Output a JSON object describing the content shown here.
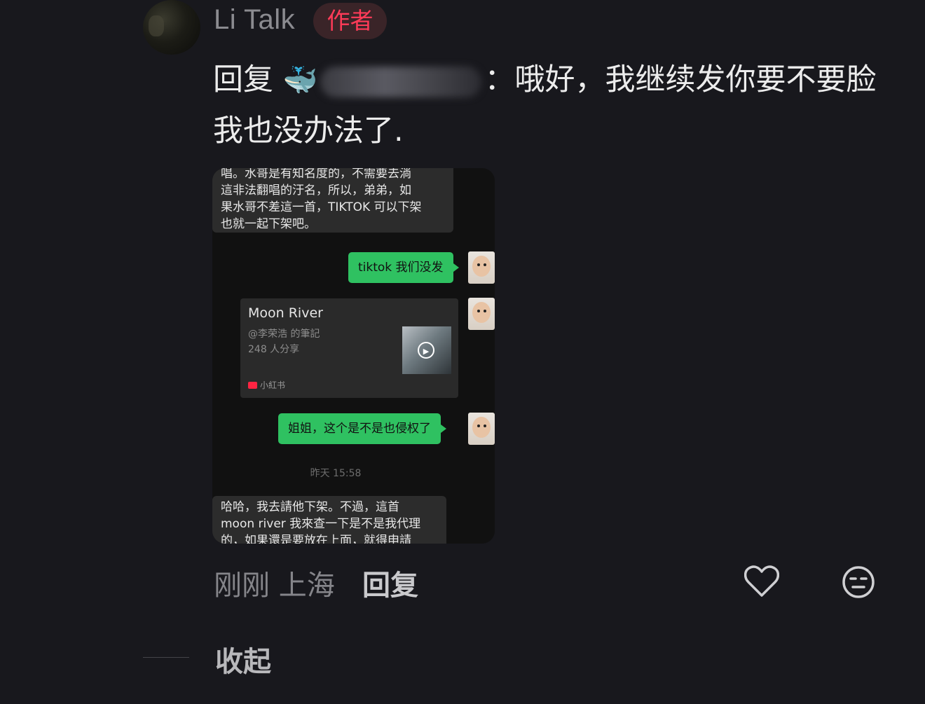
{
  "author": {
    "name": "Li Talk",
    "badge": "作者"
  },
  "comment": {
    "prefix": "回复",
    "emoji": "🐳",
    "redacted_name": "(blurred)",
    "text": "：哦好，我继续发你要不要脸我也没办法了."
  },
  "screenshot": {
    "top_message": "唱。水哥是有知名度的，不需要去淌\n這非法翻唱的汙名，所以，弟弟，如\n果水哥不差這一首，TIKTOK 可以下架\n也就一起下架吧。",
    "green_1": "tiktok 我们没发",
    "card": {
      "title": "Moon River",
      "author": "@李荣浩 的筆記",
      "shares": "248 人分享",
      "source": "小紅书"
    },
    "green_2": "姐姐，这个是不是也侵权了",
    "time": "昨天 15:58",
    "bottom_message": "哈哈，我去請他下架。不過，這首\nmoon river 我來查一下是不是我代理\n的，如果還是要放在上面，就得申請"
  },
  "meta": {
    "time_location": "刚刚 上海",
    "reply": "回复"
  },
  "actions": {
    "like_icon": "heart-icon",
    "emoji_icon": "emoji-icon"
  },
  "collapse": "收起",
  "colors": {
    "background": "#18181d",
    "badge": "#ff3b58",
    "wechat_green": "#2fc161"
  }
}
